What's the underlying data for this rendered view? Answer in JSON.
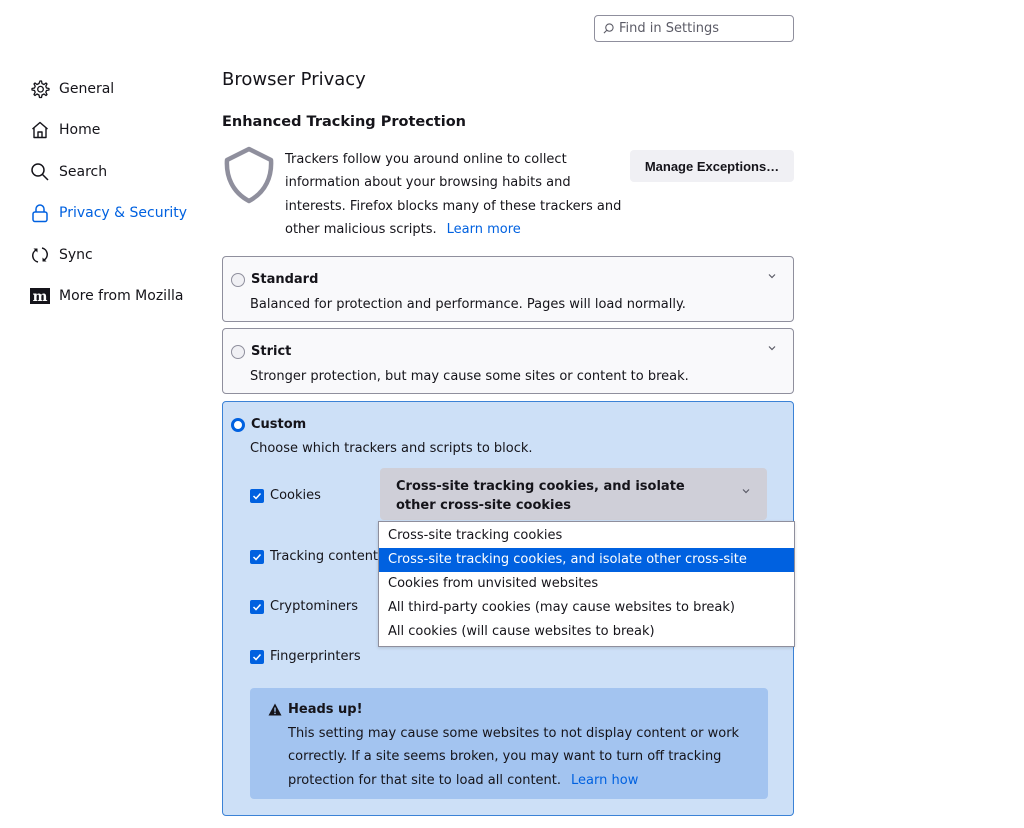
{
  "search": {
    "placeholder": "Find in Settings",
    "icon": "search-icon"
  },
  "sidebar": {
    "items": [
      {
        "label": "General",
        "icon": "gear-icon",
        "active": false
      },
      {
        "label": "Home",
        "icon": "home-icon",
        "active": false
      },
      {
        "label": "Search",
        "icon": "search-icon",
        "active": false
      },
      {
        "label": "Privacy & Security",
        "icon": "lock-icon",
        "active": true
      },
      {
        "label": "Sync",
        "icon": "sync-icon",
        "active": false
      },
      {
        "label": "More from Mozilla",
        "icon": "mozilla-icon",
        "active": false
      }
    ]
  },
  "main": {
    "title": "Browser Privacy",
    "etp": {
      "heading": "Enhanced Tracking Protection",
      "description": "Trackers follow you around online to collect information about your browsing habits and interests. Firefox blocks many of these trackers and other malicious scripts.",
      "learn_more": "Learn more",
      "manage_button": "Manage Exceptions…"
    },
    "options": {
      "standard": {
        "label": "Standard",
        "description": "Balanced for protection and performance. Pages will load normally.",
        "selected": false
      },
      "strict": {
        "label": "Strict",
        "description": "Stronger protection, but may cause some sites or content to break.",
        "selected": false
      },
      "custom": {
        "label": "Custom",
        "description": "Choose which trackers and scripts to block.",
        "selected": true,
        "checkboxes": [
          {
            "label": "Cookies",
            "checked": true
          },
          {
            "label": "Tracking content",
            "checked": true
          },
          {
            "label": "Cryptominers",
            "checked": true
          },
          {
            "label": "Fingerprinters",
            "checked": true
          }
        ],
        "cookies_select": {
          "value": "Cross-site tracking cookies, and isolate other cross-site cookies",
          "options": [
            "Cross-site tracking cookies",
            "Cross-site tracking cookies, and isolate other cross-site cookies",
            "Cookies from unvisited websites",
            "All third-party cookies (may cause websites to break)",
            "All cookies (will cause websites to break)"
          ],
          "selected_index": 1
        },
        "warning": {
          "title": "Heads up!",
          "text": "This setting may cause some websites to not display content or work correctly. If a site seems broken, you may want to turn off tracking protection for that site to load all content.",
          "link": "Learn how"
        }
      }
    }
  },
  "colors": {
    "accent": "#0061e0",
    "custom_bg": "#cde0f7",
    "warning_bg": "#a3c4f0"
  }
}
